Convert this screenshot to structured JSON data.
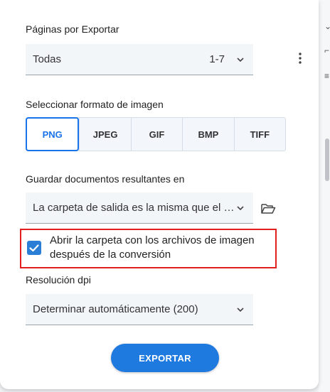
{
  "pages": {
    "label": "Páginas por Exportar",
    "selected": "Todas",
    "range": "1-7"
  },
  "format": {
    "label": "Seleccionar formato de imagen",
    "options": [
      "PNG",
      "JPEG",
      "GIF",
      "BMP",
      "TIFF"
    ],
    "selected": "PNG"
  },
  "output": {
    "label": "Guardar documentos resultantes en",
    "selected": "La carpeta de salida es la misma que el documento de origen"
  },
  "open_folder": {
    "checked": true,
    "label": "Abrir la carpeta con los archivos de imagen después de la conversión"
  },
  "resolution": {
    "label": "Resolución dpi",
    "selected": "Determinar automáticamente (200)"
  },
  "export_button": "EXPORTAR",
  "icons": {
    "more": "more-vertical-icon",
    "folder": "folder-open-icon",
    "chevron": "chevron-down-icon",
    "check": "check-icon"
  },
  "colors": {
    "accent": "#1a73e8",
    "button": "#1f7ae0",
    "highlight": "#e0201e",
    "checkbox": "#2a7ed6"
  }
}
